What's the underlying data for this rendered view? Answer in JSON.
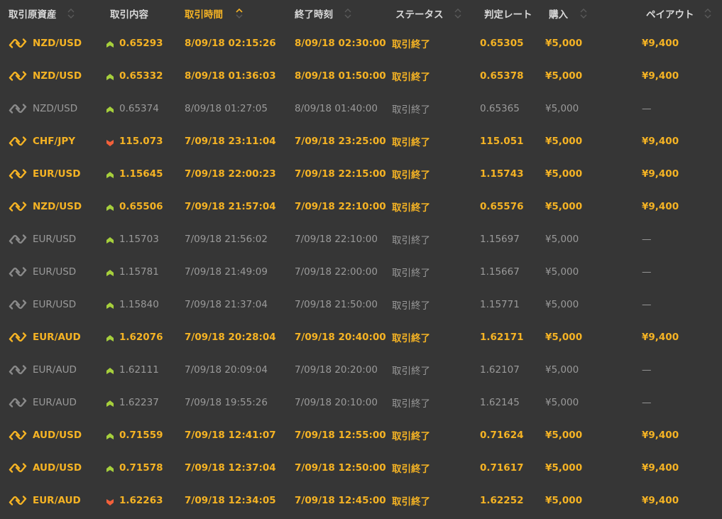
{
  "colors": {
    "background": "#363636",
    "accent_win": "#f5b324",
    "muted": "#9a9a9a",
    "arrow_up": "#a6cf3c",
    "arrow_down": "#f2603a",
    "header_text": "#d8d8d8"
  },
  "header": {
    "asset": "取引原資産",
    "rate": "取引内容",
    "trade_time": "取引時間",
    "end_time": "終了時刻",
    "status": "ステータス",
    "judge_rate": "判定レート",
    "purchase": "購入",
    "payout": "ペイアウト",
    "active_sort_column": "取引時間"
  },
  "rows": [
    {
      "result": "win",
      "icon": "pair-icon",
      "asset": "NZD/USD",
      "direction": "up",
      "rate": "0.65293",
      "trade_time": "8/09/18 02:15:26",
      "end_time": "8/09/18 02:30:00",
      "status": "取引終了",
      "judge_rate": "0.65305",
      "purchase": "¥5,000",
      "payout": "¥9,400"
    },
    {
      "result": "win",
      "icon": "pair-icon",
      "asset": "NZD/USD",
      "direction": "up",
      "rate": "0.65332",
      "trade_time": "8/09/18 01:36:03",
      "end_time": "8/09/18 01:50:00",
      "status": "取引終了",
      "judge_rate": "0.65378",
      "purchase": "¥5,000",
      "payout": "¥9,400"
    },
    {
      "result": "lose",
      "icon": "pair-icon",
      "asset": "NZD/USD",
      "direction": "up",
      "rate": "0.65374",
      "trade_time": "8/09/18 01:27:05",
      "end_time": "8/09/18 01:40:00",
      "status": "取引終了",
      "judge_rate": "0.65365",
      "purchase": "¥5,000",
      "payout": "—"
    },
    {
      "result": "win",
      "icon": "pair-icon",
      "asset": "CHF/JPY",
      "direction": "down",
      "rate": "115.073",
      "trade_time": "7/09/18 23:11:04",
      "end_time": "7/09/18 23:25:00",
      "status": "取引終了",
      "judge_rate": "115.051",
      "purchase": "¥5,000",
      "payout": "¥9,400"
    },
    {
      "result": "win",
      "icon": "pair-icon",
      "asset": "EUR/USD",
      "direction": "up",
      "rate": "1.15645",
      "trade_time": "7/09/18 22:00:23",
      "end_time": "7/09/18 22:15:00",
      "status": "取引終了",
      "judge_rate": "1.15743",
      "purchase": "¥5,000",
      "payout": "¥9,400"
    },
    {
      "result": "win",
      "icon": "pair-icon",
      "asset": "NZD/USD",
      "direction": "up",
      "rate": "0.65506",
      "trade_time": "7/09/18 21:57:04",
      "end_time": "7/09/18 22:10:00",
      "status": "取引終了",
      "judge_rate": "0.65576",
      "purchase": "¥5,000",
      "payout": "¥9,400"
    },
    {
      "result": "lose",
      "icon": "pair-icon",
      "asset": "EUR/USD",
      "direction": "up",
      "rate": "1.15703",
      "trade_time": "7/09/18 21:56:02",
      "end_time": "7/09/18 22:10:00",
      "status": "取引終了",
      "judge_rate": "1.15697",
      "purchase": "¥5,000",
      "payout": "—"
    },
    {
      "result": "lose",
      "icon": "pair-icon",
      "asset": "EUR/USD",
      "direction": "up",
      "rate": "1.15781",
      "trade_time": "7/09/18 21:49:09",
      "end_time": "7/09/18 22:00:00",
      "status": "取引終了",
      "judge_rate": "1.15667",
      "purchase": "¥5,000",
      "payout": "—"
    },
    {
      "result": "lose",
      "icon": "pair-icon",
      "asset": "EUR/USD",
      "direction": "up",
      "rate": "1.15840",
      "trade_time": "7/09/18 21:37:04",
      "end_time": "7/09/18 21:50:00",
      "status": "取引終了",
      "judge_rate": "1.15771",
      "purchase": "¥5,000",
      "payout": "—"
    },
    {
      "result": "win",
      "icon": "pair-icon",
      "asset": "EUR/AUD",
      "direction": "up",
      "rate": "1.62076",
      "trade_time": "7/09/18 20:28:04",
      "end_time": "7/09/18 20:40:00",
      "status": "取引終了",
      "judge_rate": "1.62171",
      "purchase": "¥5,000",
      "payout": "¥9,400"
    },
    {
      "result": "lose",
      "icon": "pair-icon",
      "asset": "EUR/AUD",
      "direction": "up",
      "rate": "1.62111",
      "trade_time": "7/09/18 20:09:04",
      "end_time": "7/09/18 20:20:00",
      "status": "取引終了",
      "judge_rate": "1.62107",
      "purchase": "¥5,000",
      "payout": "—"
    },
    {
      "result": "lose",
      "icon": "pair-icon",
      "asset": "EUR/AUD",
      "direction": "up",
      "rate": "1.62237",
      "trade_time": "7/09/18 19:55:26",
      "end_time": "7/09/18 20:10:00",
      "status": "取引終了",
      "judge_rate": "1.62145",
      "purchase": "¥5,000",
      "payout": "—"
    },
    {
      "result": "win",
      "icon": "pair-icon",
      "asset": "AUD/USD",
      "direction": "up",
      "rate": "0.71559",
      "trade_time": "7/09/18 12:41:07",
      "end_time": "7/09/18 12:55:00",
      "status": "取引終了",
      "judge_rate": "0.71624",
      "purchase": "¥5,000",
      "payout": "¥9,400"
    },
    {
      "result": "win",
      "icon": "pair-icon",
      "asset": "AUD/USD",
      "direction": "up",
      "rate": "0.71578",
      "trade_time": "7/09/18 12:37:04",
      "end_time": "7/09/18 12:50:00",
      "status": "取引終了",
      "judge_rate": "0.71617",
      "purchase": "¥5,000",
      "payout": "¥9,400"
    },
    {
      "result": "win",
      "icon": "pair-icon",
      "asset": "EUR/AUD",
      "direction": "down",
      "rate": "1.62263",
      "trade_time": "7/09/18 12:34:05",
      "end_time": "7/09/18 12:45:00",
      "status": "取引終了",
      "judge_rate": "1.62252",
      "purchase": "¥5,000",
      "payout": "¥9,400"
    }
  ]
}
